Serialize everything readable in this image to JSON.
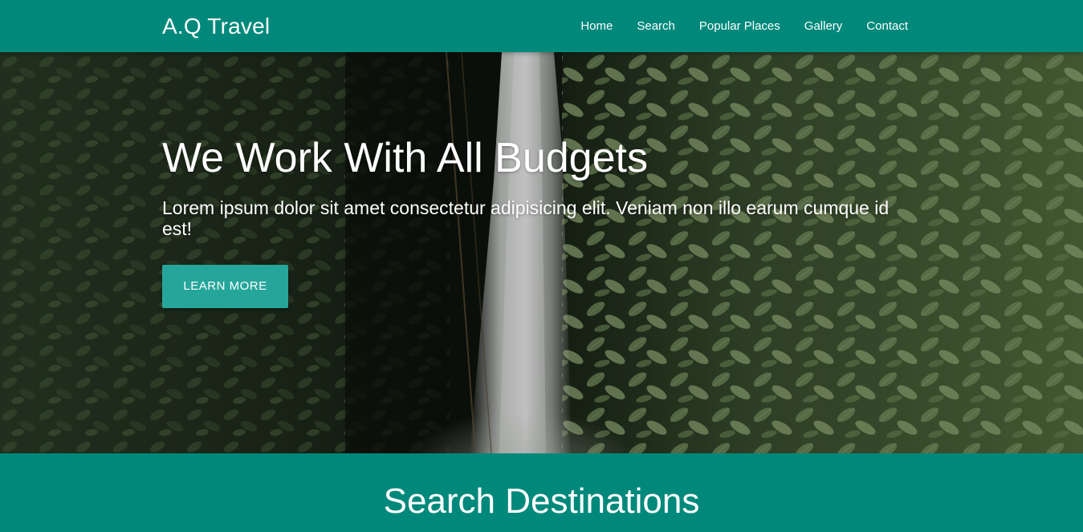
{
  "navbar": {
    "brand": "A.Q Travel",
    "links": [
      "Home",
      "Search",
      "Popular Places",
      "Gallery",
      "Contact"
    ]
  },
  "hero": {
    "title": "We Work With All Budgets",
    "text": "Lorem ipsum dolor sit amet consectetur adipisicing elit. Veniam non illo earum cumque id est!",
    "button_label": "LEARN MORE",
    "background_image": "waterfall-jungle-image"
  },
  "search": {
    "title": "Search Destinations"
  },
  "colors": {
    "primary": "#00897b",
    "button": "#26a69a",
    "text": "#ffffff"
  }
}
